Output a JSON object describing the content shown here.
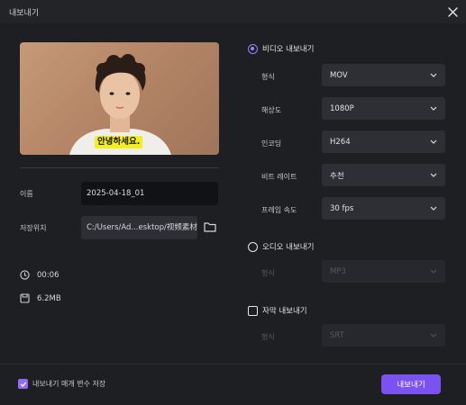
{
  "window": {
    "title": "내보내기"
  },
  "preview": {
    "caption": "안녕하세요."
  },
  "file": {
    "name_label": "이름",
    "name_value": "2025-04-18_01",
    "location_label": "저장위치",
    "location_value": "C:/Users/Ad...esktop/视频素材",
    "duration": "00:06",
    "size": "6.2MB"
  },
  "video_export": {
    "label": "비디오 내보내기",
    "selected": true,
    "rows": [
      {
        "label": "형식",
        "value": "MOV"
      },
      {
        "label": "해상도",
        "value": "1080P"
      },
      {
        "label": "인코딩",
        "value": "H264"
      },
      {
        "label": "비트 레이트",
        "value": "추천"
      },
      {
        "label": "프레임 속도",
        "value": "30  fps"
      }
    ]
  },
  "audio_export": {
    "label": "오디오 내보내기",
    "selected": false,
    "format_label": "형식",
    "format_value": "MP3"
  },
  "subtitle_export": {
    "label": "자막 내보내기",
    "checked": false,
    "format_label": "형식",
    "format_value": "SRT"
  },
  "footer": {
    "save_params_label": "내보내기 매개 변수 저장",
    "save_params_checked": true,
    "export_button": "내보내기"
  },
  "colors": {
    "accent": "#7b52f0",
    "background": "#1e1f23",
    "caption_bg": "#f4ee1f"
  }
}
